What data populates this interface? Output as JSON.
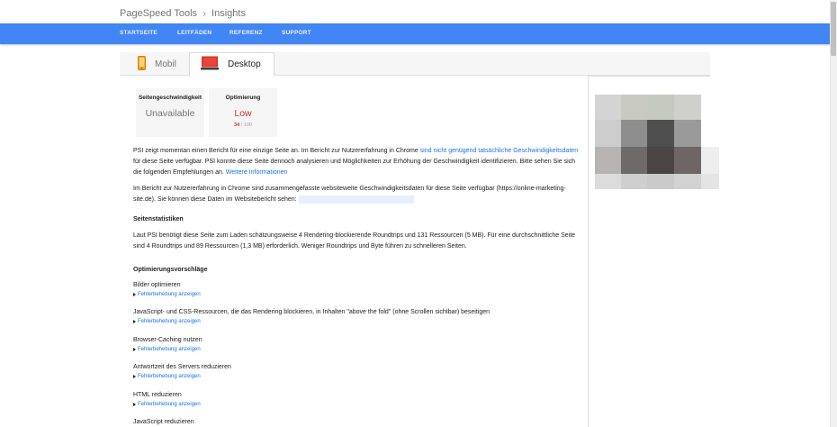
{
  "breadcrumb": {
    "root": "PageSpeed Tools",
    "separator": "›",
    "current": "Insights"
  },
  "nav": {
    "items": [
      {
        "label": "STARTSEITE"
      },
      {
        "label": "LEITFÄDEN"
      },
      {
        "label": "REFERENZ"
      },
      {
        "label": "SUPPORT"
      }
    ]
  },
  "tabs": [
    {
      "label": "Mobil",
      "icon": "mobile-icon"
    },
    {
      "label": "Desktop",
      "icon": "desktop-icon",
      "active": true
    }
  ],
  "metrics": {
    "speed": {
      "title": "Seitengeschwindigkeit",
      "value": "Unavailable"
    },
    "optimization": {
      "title": "Optimierung",
      "value": "Low",
      "score": "34",
      "score_suffix": "/ 100"
    }
  },
  "intro": {
    "text_a": "PSI zeigt momentan einen Bericht für eine einzige Seite an. Im Bericht zur Nutzererfahrung in Chrome ",
    "link_a": "sind nicht genügend tatsächliche Geschwindigkeitsdaten",
    "text_b": " für diese Seite verfügbar. PSI konnte diese Seite dennoch analysieren und Möglichkeiten zur Erhöhung der Geschwindigkeit identifizieren. Bitte sehen Sie sich die folgenden Empfehlungen an. ",
    "link_b": "Weitere Informationen"
  },
  "site_report": {
    "text": "Im Bericht zur Nutzererfahrung in Chrome sind zusammengefasste websiteweite Geschwindigkeitsdaten für diese Seite verfügbar (https://online-marketing-site.de). Sie können diese Daten im Websitebericht sehen: "
  },
  "stats": {
    "heading": "Seitenstatistiken",
    "text": "Laut PSI benötigt diese Seite zum Laden schätzungsweise 4 Rendering-blockierende Roundtrips und 131 Ressourcen (5 MB). Für eine durchschnittliche Seite sind 4 Roundtrips und 89 Ressourcen (1,3 MB) erforderlich. Weniger Roundtrips und Byte führen zu schnelleren Seiten."
  },
  "optimizations": {
    "heading": "Optimierungsvorschläge",
    "fix_label": "Fehlerbehebung anzeigen",
    "items": [
      {
        "title": "Bilder optimieren"
      },
      {
        "title": "JavaScript- und CSS-Ressourcen, die das Rendering blockieren, in Inhalten \"above the fold\" (ohne Scrollen sichtbar) beseitigen"
      },
      {
        "title": "Browser-Caching nutzen"
      },
      {
        "title": "Antwortzeit des Servers reduzieren"
      },
      {
        "title": "HTML reduzieren"
      },
      {
        "title": "JavaScript reduzieren"
      }
    ]
  },
  "colors": {
    "nav_blue": "#4285f4",
    "link_blue": "#1a73e8",
    "low_red": "#c0392b",
    "metric_bg": "#f5f5f5"
  }
}
